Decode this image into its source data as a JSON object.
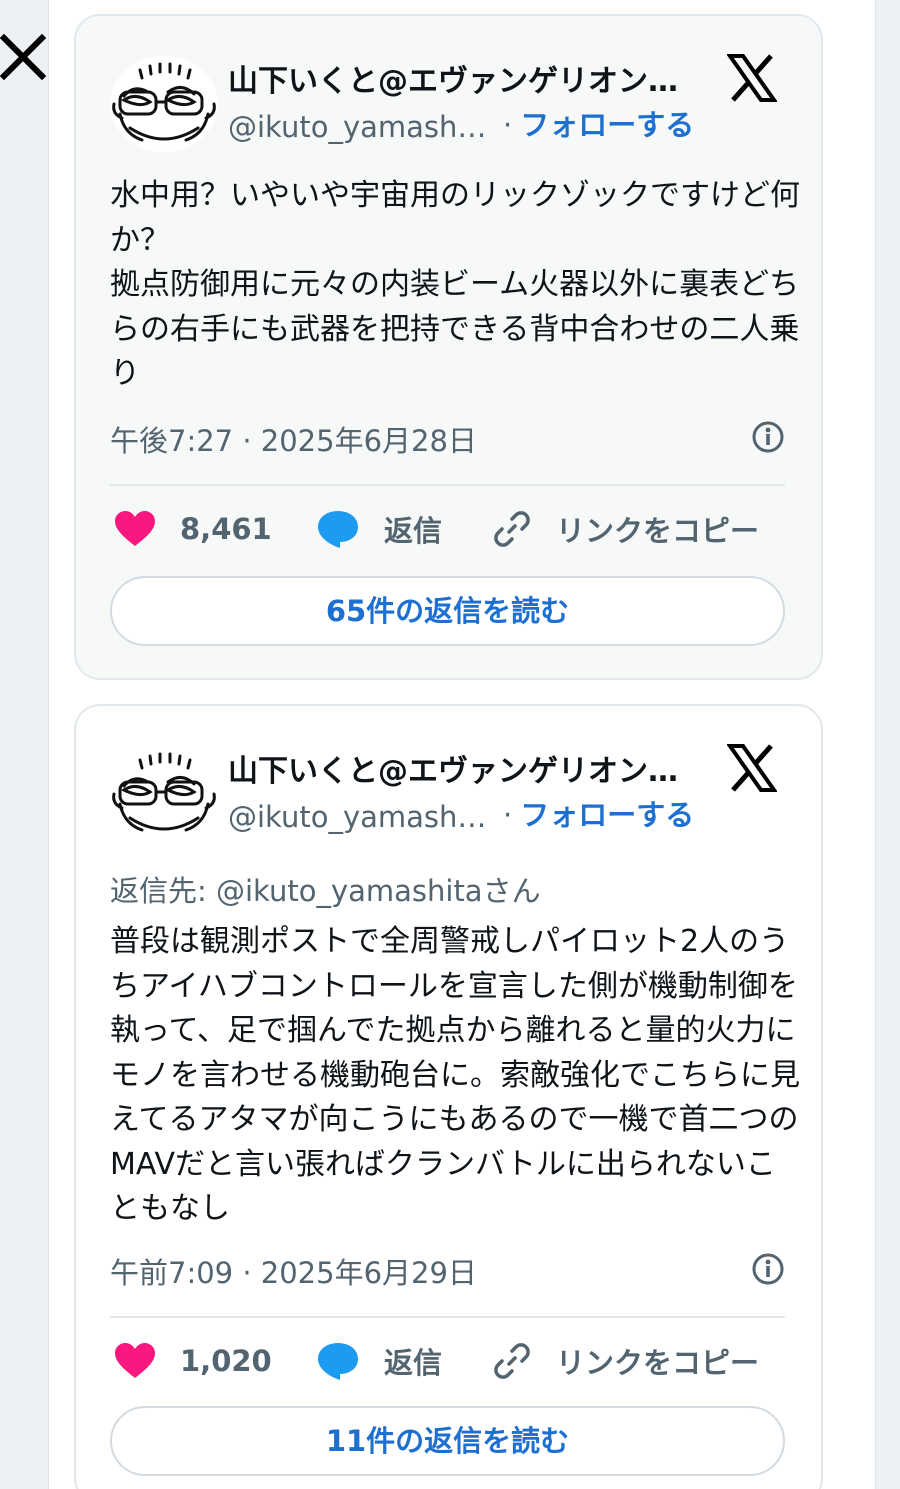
{
  "colors": {
    "accent": "#1d6fd0",
    "like": "#f91880",
    "reply": "#1d9bf0",
    "muted": "#536471"
  },
  "tweets": [
    {
      "name": "山下いくと@エヴァンゲリオン…",
      "handle": "@ikuto_yamashi…",
      "follow_label": "フォローする",
      "reply_to": "",
      "text": "水中用？いやいや宇宙用のリックゾックですけど何か？\n拠点防御用に元々の内装ビーム火器以外に裏表どちらの右手にも武器を把持できる背中合わせの二人乗り",
      "timestamp": "午後7:27 · 2025年6月28日",
      "likes": "8,461",
      "reply_label": "返信",
      "copy_label": "リンクをコピー",
      "read_replies": "65件の返信を読む"
    },
    {
      "name": "山下いくと@エヴァンゲリオン…",
      "handle": "@ikuto_yamashi…",
      "follow_label": "フォローする",
      "reply_to": "返信先: @ikuto_yamashitaさん",
      "text": "普段は観測ポストで全周警戒しパイロット2人のうちアイハブコントロールを宣言した側が機動制御を執って、足で掴んでた拠点から離れると量的火力にモノを言わせる機動砲台に。索敵強化でこちらに見えてるアタマが向こうにもあるので一機で首二つのMAVだと言い張ればクランバトルに出られないこともなし",
      "timestamp": "午前7:09 · 2025年6月29日",
      "likes": "1,020",
      "reply_label": "返信",
      "copy_label": "リンクをコピー",
      "read_replies": "11件の返信を読む"
    }
  ]
}
